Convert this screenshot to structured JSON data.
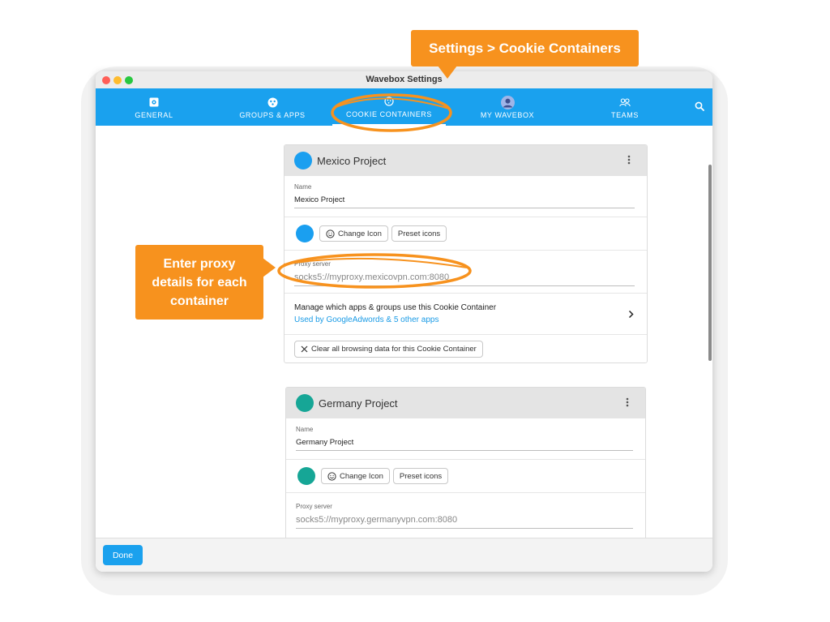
{
  "window": {
    "title": "Wavebox Settings"
  },
  "nav": {
    "items": [
      {
        "label": "GENERAL",
        "icon": "gear-square-icon"
      },
      {
        "label": "GROUPS & APPS",
        "icon": "groups-icon"
      },
      {
        "label": "COOKIE CONTAINERS",
        "icon": "cookie-icon",
        "active": true
      },
      {
        "label": "MY WAVEBOX",
        "icon": "avatar-icon"
      },
      {
        "label": "TEAMS",
        "icon": "team-icon"
      }
    ],
    "search_icon": "search-icon",
    "color": "#1aa1ee"
  },
  "containers": [
    {
      "title": "Mexico Project",
      "color": "#1a9ff0",
      "name_label": "Name",
      "name_value": "Mexico Project",
      "change_icon_label": "Change Icon",
      "preset_icons_label": "Preset icons",
      "proxy_label": "Proxy server",
      "proxy_placeholder": "socks5://myproxy.mexicovpn.com:8080",
      "manage_title": "Manage which apps & groups use this Cookie Container",
      "manage_link": "Used by GoogleAdwords & 5 other apps",
      "clear_label": "Clear all browsing data for this Cookie Container"
    },
    {
      "title": "Germany Project",
      "color": "#16a696",
      "name_label": "Name",
      "name_value": "Germany Project",
      "change_icon_label": "Change Icon",
      "preset_icons_label": "Preset icons",
      "proxy_label": "Proxy server",
      "proxy_placeholder": "socks5://myproxy.germanyvpn.com:8080"
    }
  ],
  "footer": {
    "done_label": "Done"
  },
  "callouts": {
    "top": "Settings > Cookie Containers",
    "side_lines": [
      "Enter proxy",
      "details for each",
      "container"
    ],
    "color": "#f7921e"
  }
}
